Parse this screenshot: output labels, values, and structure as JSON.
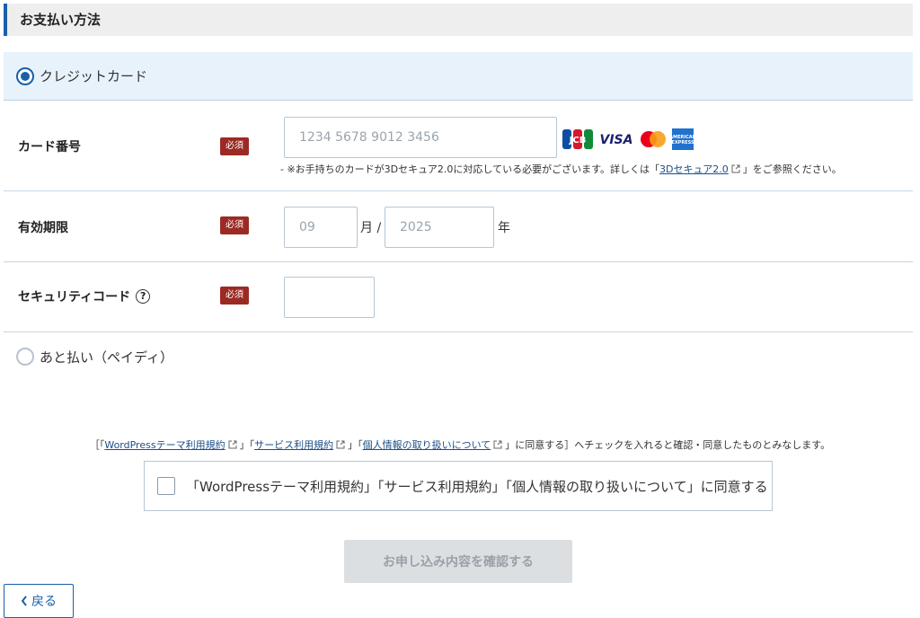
{
  "section": {
    "title": "お支払い方法"
  },
  "payment_methods": {
    "credit_card": {
      "label": "クレジットカード",
      "selected": true
    },
    "paidy": {
      "label": "あと払い（ペイディ）",
      "selected": false
    }
  },
  "card_number": {
    "label": "カード番号",
    "required_badge": "必須",
    "placeholder": "1234 5678 9012 3456",
    "brands": [
      "JCB",
      "VISA",
      "Mastercard",
      "AMEX"
    ],
    "note_prefix": "- ※お手持ちのカードが3Dセキュア2.0に対応している必要がございます。詳しくは「",
    "note_link": "3Dセキュア2.0",
    "note_suffix": "」をご参照ください。"
  },
  "expiry": {
    "label": "有効期限",
    "required_badge": "必須",
    "month_placeholder": "09",
    "month_unit": "月 /",
    "year_placeholder": "2025",
    "year_unit": "年"
  },
  "security_code": {
    "label": "セキュリティコード",
    "required_badge": "必須",
    "help_icon": "?"
  },
  "agreement": {
    "note_open": "［「",
    "link1": "WordPressテーマ利用規約",
    "sep1": "」「",
    "link2": "サービス利用規約",
    "sep2": "」「",
    "link3": "個人情報の取り扱いについて",
    "note_close": "」に同意する］へチェックを入れると確認・同意したものとみなします。",
    "checkbox_label": "「WordPressテーマ利用規約」「サービス利用規約」「個人情報の取り扱いについて」に同意する",
    "checked": false
  },
  "buttons": {
    "submit": "お申し込み内容を確認する",
    "back": "戻る"
  },
  "colors": {
    "accent": "#1b5fa8",
    "required_badge": "#9c2a24",
    "selected_bg": "#e8f2fb",
    "disabled_button": "#dcdfe2"
  }
}
